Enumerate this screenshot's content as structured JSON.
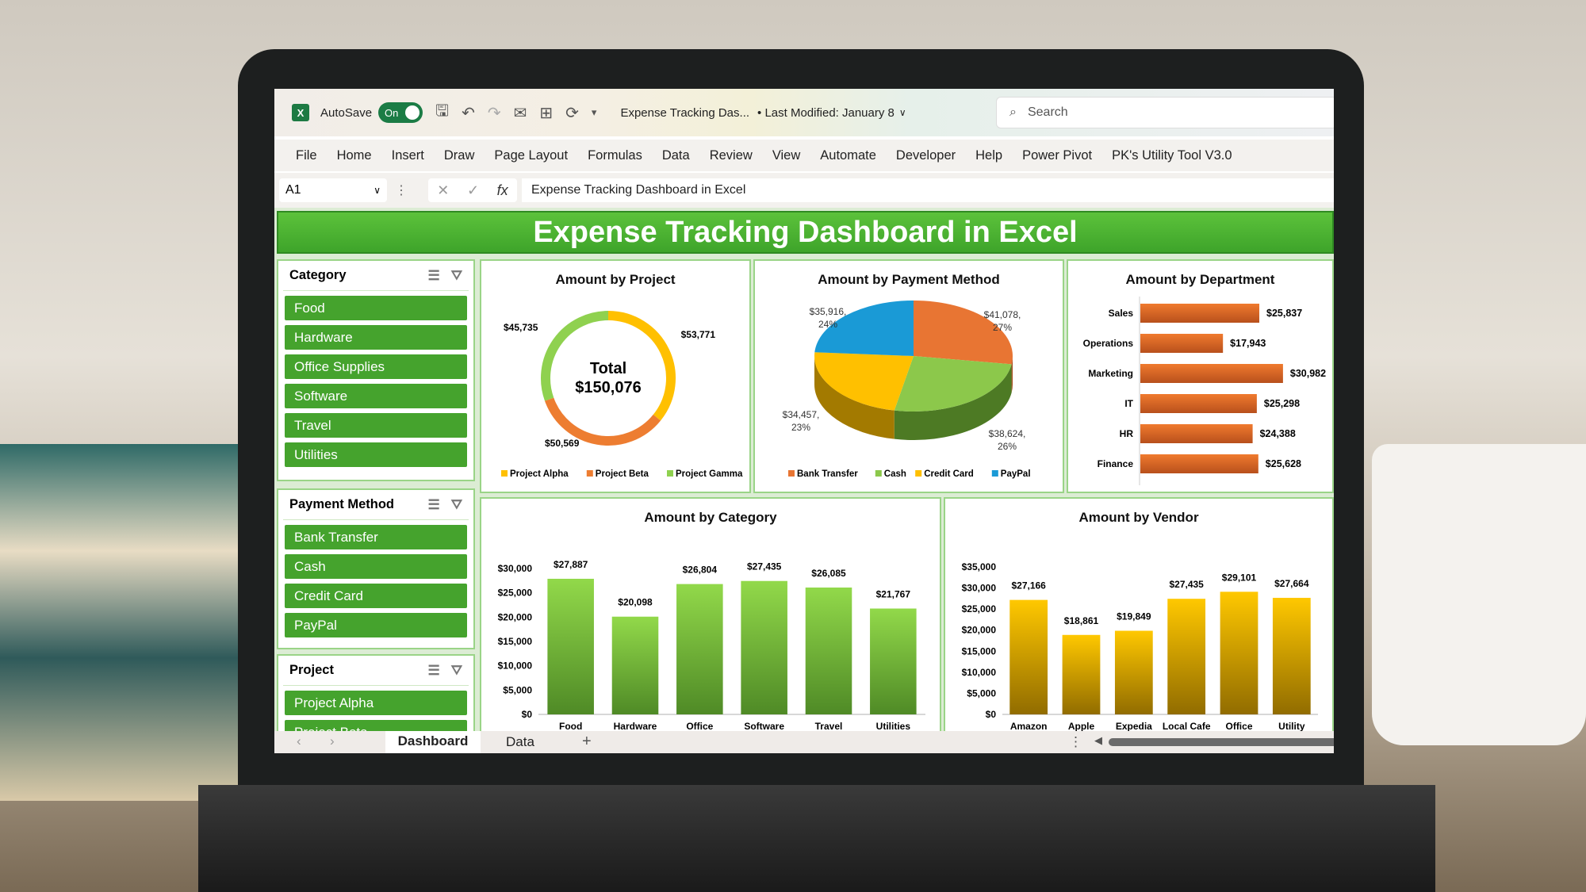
{
  "titlebar": {
    "app_icon": "excel-icon",
    "autosave_label": "AutoSave",
    "autosave_state": "On",
    "file_title": "Expense Tracking Das...",
    "modified": "• Last Modified: January 8",
    "search_placeholder": "Search"
  },
  "ribbon": {
    "tabs": [
      "File",
      "Home",
      "Insert",
      "Draw",
      "Page Layout",
      "Formulas",
      "Data",
      "Review",
      "View",
      "Automate",
      "Developer",
      "Help",
      "Power Pivot",
      "PK's Utility Tool V3.0"
    ]
  },
  "formula_bar": {
    "cell": "A1",
    "fx": "fx",
    "value": "Expense Tracking Dashboard in Excel"
  },
  "dashboard": {
    "title": "Expense Tracking Dashboard in Excel"
  },
  "slicers": [
    {
      "title": "Category",
      "items": [
        "Food",
        "Hardware",
        "Office Supplies",
        "Software",
        "Travel",
        "Utilities"
      ]
    },
    {
      "title": "Payment Method",
      "items": [
        "Bank Transfer",
        "Cash",
        "Credit Card",
        "PayPal"
      ]
    },
    {
      "title": "Project",
      "items": [
        "Project Alpha",
        "Project Beta"
      ]
    }
  ],
  "sheet_tabs": {
    "tabs": [
      "Dashboard",
      "Data"
    ],
    "active": "Dashboard",
    "add": "+"
  },
  "chart_data": [
    {
      "type": "pie",
      "title": "Amount by Project",
      "center_label": "Total",
      "center_value": "$150,076",
      "categories": [
        "Project Alpha",
        "Project Beta",
        "Project Gamma"
      ],
      "values": [
        53771,
        50569,
        45735
      ],
      "labels": [
        "$53,771",
        "$50,569",
        "$45,735"
      ],
      "colors": [
        "#ffc000",
        "#ed7d31",
        "#8fd14f"
      ],
      "legend": "bottom"
    },
    {
      "type": "pie",
      "title": "Amount by Payment Method",
      "categories": [
        "Bank Transfer",
        "Cash",
        "Credit Card",
        "PayPal"
      ],
      "values": [
        41078,
        38624,
        34457,
        35916
      ],
      "labels": [
        "$41,078, 27%",
        "$38,624, 26%",
        "$34,457, 23%",
        "$35,916, 24%"
      ],
      "colors": [
        "#e87533",
        "#8cc84b",
        "#ffc000",
        "#1a9ad6"
      ],
      "legend": "bottom"
    },
    {
      "type": "bar",
      "orientation": "horizontal",
      "title": "Amount by Department",
      "categories": [
        "Sales",
        "Operations",
        "Marketing",
        "IT",
        "HR",
        "Finance"
      ],
      "values": [
        25837,
        17943,
        30982,
        25298,
        24388,
        25628
      ],
      "labels": [
        "$25,837",
        "$17,943",
        "$30,982",
        "$25,298",
        "$24,388",
        "$25,628"
      ],
      "color": "#e0662a"
    },
    {
      "type": "bar",
      "title": "Amount by Category",
      "categories": [
        "Food",
        "Hardware",
        "Office",
        "Software",
        "Travel",
        "Utilities"
      ],
      "values": [
        27887,
        20098,
        26804,
        27435,
        26085,
        21767
      ],
      "labels": [
        "$27,887",
        "$20,098",
        "$26,804",
        "$27,435",
        "$26,085",
        "$21,767"
      ],
      "ylim": [
        0,
        30000
      ],
      "yticks": [
        "$0",
        "$5,000",
        "$10,000",
        "$15,000",
        "$20,000",
        "$25,000",
        "$30,000"
      ],
      "color": "#7ac943"
    },
    {
      "type": "bar",
      "title": "Amount by Vendor",
      "categories": [
        "Amazon",
        "Apple",
        "Expedia",
        "Local Cafe",
        "Office",
        "Utility"
      ],
      "values": [
        27166,
        18861,
        19849,
        27435,
        29101,
        27664
      ],
      "labels": [
        "$27,166",
        "$18,861",
        "$19,849",
        "$27,435",
        "$29,101",
        "$27,664"
      ],
      "ylim": [
        0,
        35000
      ],
      "yticks": [
        "$0",
        "$5,000",
        "$10,000",
        "$15,000",
        "$20,000",
        "$25,000",
        "$30,000",
        "$35,000"
      ],
      "color": "#f5be00"
    }
  ]
}
